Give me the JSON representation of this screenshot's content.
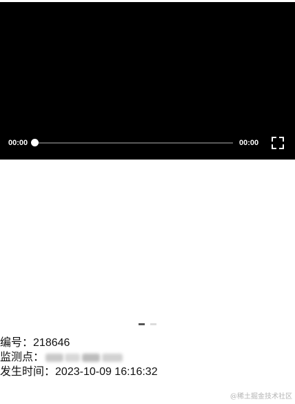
{
  "player": {
    "current_time": "00:00",
    "duration": "00:00",
    "progress": 0
  },
  "carousel": {
    "count": 2,
    "active_index": 0
  },
  "record": {
    "id_label": "编号：",
    "id_value": "218646",
    "location_label": "监测点：",
    "location_value": "[blurred]",
    "time_label": "发生时间：",
    "time_value": "2023-10-09 16:16:32"
  },
  "watermark": "@稀土掘金技术社区",
  "colors": {
    "player_bg": "#000000",
    "dot_active": "#555555",
    "dot_inactive": "#dcdcdc"
  }
}
